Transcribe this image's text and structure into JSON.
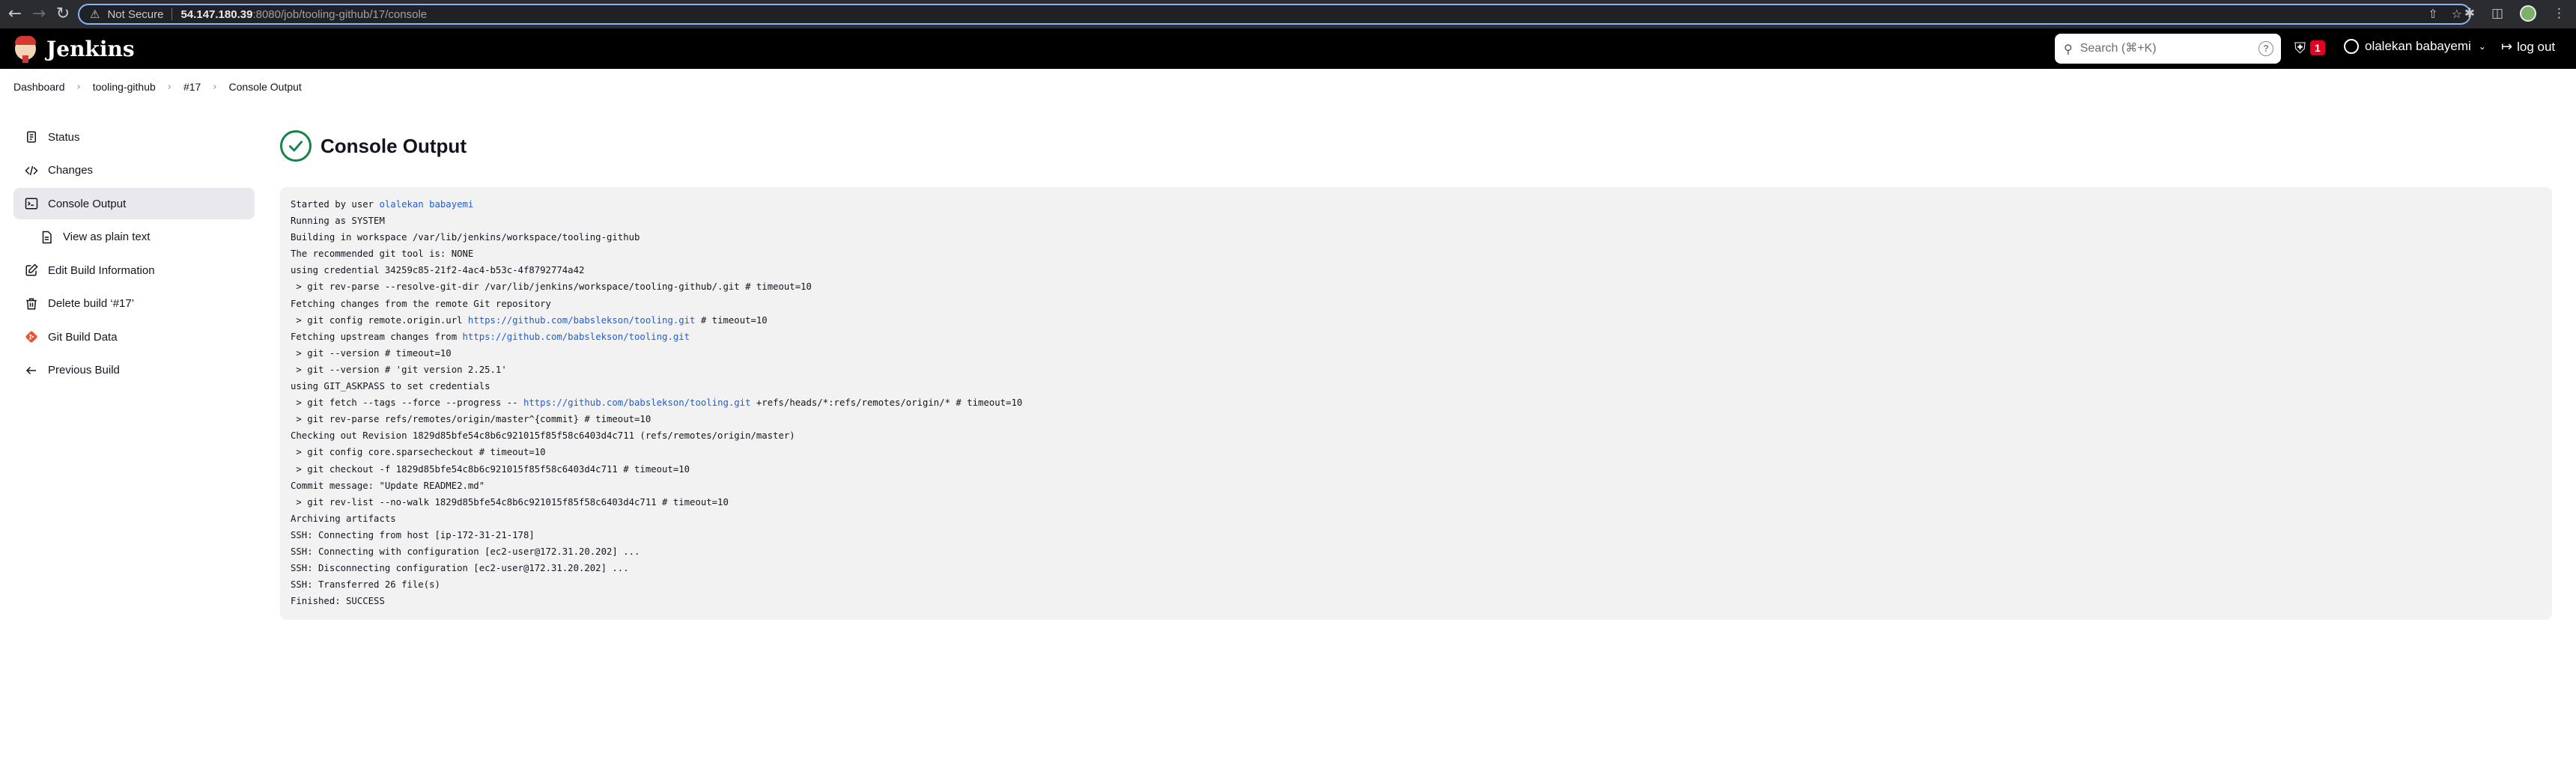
{
  "browser": {
    "security_label": "Not Secure",
    "url_host": "54.147.180.39",
    "url_rest": ":8080/job/tooling-github/17/console"
  },
  "header": {
    "logo_text": "Jenkins",
    "search_placeholder": "Search (⌘+K)",
    "security_count": "1",
    "user_name": "olalekan babayemi",
    "logout_label": "log out"
  },
  "breadcrumb": [
    "Dashboard",
    "tooling-github",
    "#17",
    "Console Output"
  ],
  "sidebar": {
    "items": [
      {
        "label": "Status",
        "icon": "status-icon"
      },
      {
        "label": "Changes",
        "icon": "code-icon"
      },
      {
        "label": "Console Output",
        "icon": "terminal-icon"
      },
      {
        "label": "View as plain text",
        "icon": "document-icon"
      },
      {
        "label": "Edit Build Information",
        "icon": "edit-icon"
      },
      {
        "label": "Delete build ‘#17’",
        "icon": "trash-icon"
      },
      {
        "label": "Git Build Data",
        "icon": "git-icon"
      },
      {
        "label": "Previous Build",
        "icon": "arrow-left-icon"
      }
    ]
  },
  "main": {
    "title": "Console Output",
    "status": "success"
  },
  "console": {
    "lines": [
      {
        "text": "Started by user ",
        "link": "olalekan babayemi",
        "after": ""
      },
      {
        "text": "Running as SYSTEM"
      },
      {
        "text": "Building in workspace /var/lib/jenkins/workspace/tooling-github"
      },
      {
        "text": "The recommended git tool is: NONE"
      },
      {
        "text": "using credential 34259c85-21f2-4ac4-b53c-4f8792774a42"
      },
      {
        "text": " > git rev-parse --resolve-git-dir /var/lib/jenkins/workspace/tooling-github/.git # timeout=10"
      },
      {
        "text": "Fetching changes from the remote Git repository"
      },
      {
        "text": " > git config remote.origin.url ",
        "link": "https://github.com/babslekson/tooling.git",
        "after": " # timeout=10"
      },
      {
        "text": "Fetching upstream changes from ",
        "link": "https://github.com/babslekson/tooling.git",
        "after": ""
      },
      {
        "text": " > git --version # timeout=10"
      },
      {
        "text": " > git --version # 'git version 2.25.1'"
      },
      {
        "text": "using GIT_ASKPASS to set credentials"
      },
      {
        "text": " > git fetch --tags --force --progress -- ",
        "link": "https://github.com/babslekson/tooling.git",
        "after": " +refs/heads/*:refs/remotes/origin/* # timeout=10"
      },
      {
        "text": " > git rev-parse refs/remotes/origin/master^{commit} # timeout=10"
      },
      {
        "text": "Checking out Revision 1829d85bfe54c8b6c921015f85f58c6403d4c711 (refs/remotes/origin/master)"
      },
      {
        "text": " > git config core.sparsecheckout # timeout=10"
      },
      {
        "text": " > git checkout -f 1829d85bfe54c8b6c921015f85f58c6403d4c711 # timeout=10"
      },
      {
        "text": "Commit message: \"Update README2.md\""
      },
      {
        "text": " > git rev-list --no-walk 1829d85bfe54c8b6c921015f85f58c6403d4c711 # timeout=10"
      },
      {
        "text": "Archiving artifacts"
      },
      {
        "text": "SSH: Connecting from host [ip-172-31-21-178]"
      },
      {
        "text": "SSH: Connecting with configuration [ec2-user@172.31.20.202] ..."
      },
      {
        "text": "SSH: Disconnecting configuration [ec2-user@172.31.20.202] ..."
      },
      {
        "text": "SSH: Transferred 26 file(s)"
      },
      {
        "text": "Finished: SUCCESS"
      }
    ]
  },
  "colors": {
    "header_bg": "#000000",
    "success_green": "#138347",
    "link_blue": "#1d5ed3",
    "badge_red": "#e6001f"
  }
}
